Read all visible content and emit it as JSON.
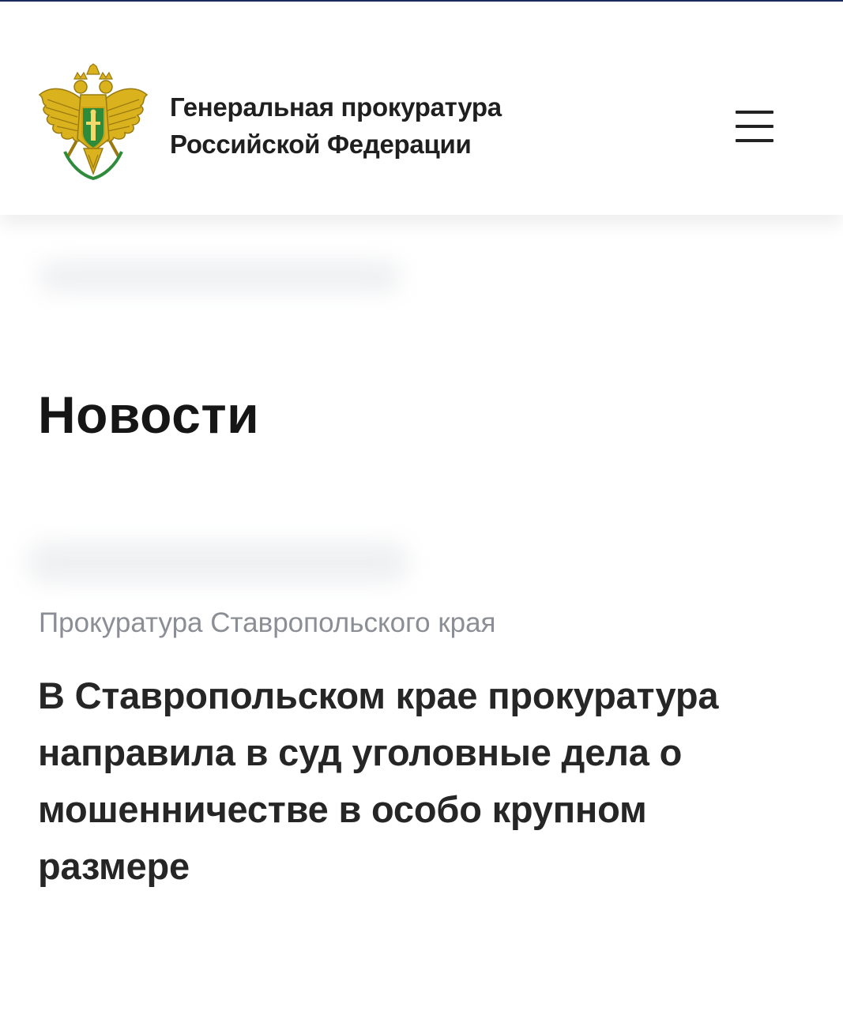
{
  "header": {
    "org_name_line1": "Генеральная прокуратура",
    "org_name_line2": "Российской Федерации",
    "emblem_icon": "prosecutor-emblem-double-headed-eagle",
    "menu_icon": "hamburger-menu-icon"
  },
  "main": {
    "section_title": "Новости",
    "news": [
      {
        "source": "Прокуратура Ставропольского края",
        "headline_lines": [
          "В Ставропольском крае прокуратура",
          "направила в суд уголовные дела о",
          "мошенничестве в особо крупном",
          "размере"
        ]
      }
    ]
  },
  "colors": {
    "top_line": "#1d2a5c",
    "emblem_gold": "#d9b21e",
    "emblem_green": "#2e8b3a",
    "text_dark": "#1f1f1f",
    "source_gray": "#8c8e95"
  }
}
